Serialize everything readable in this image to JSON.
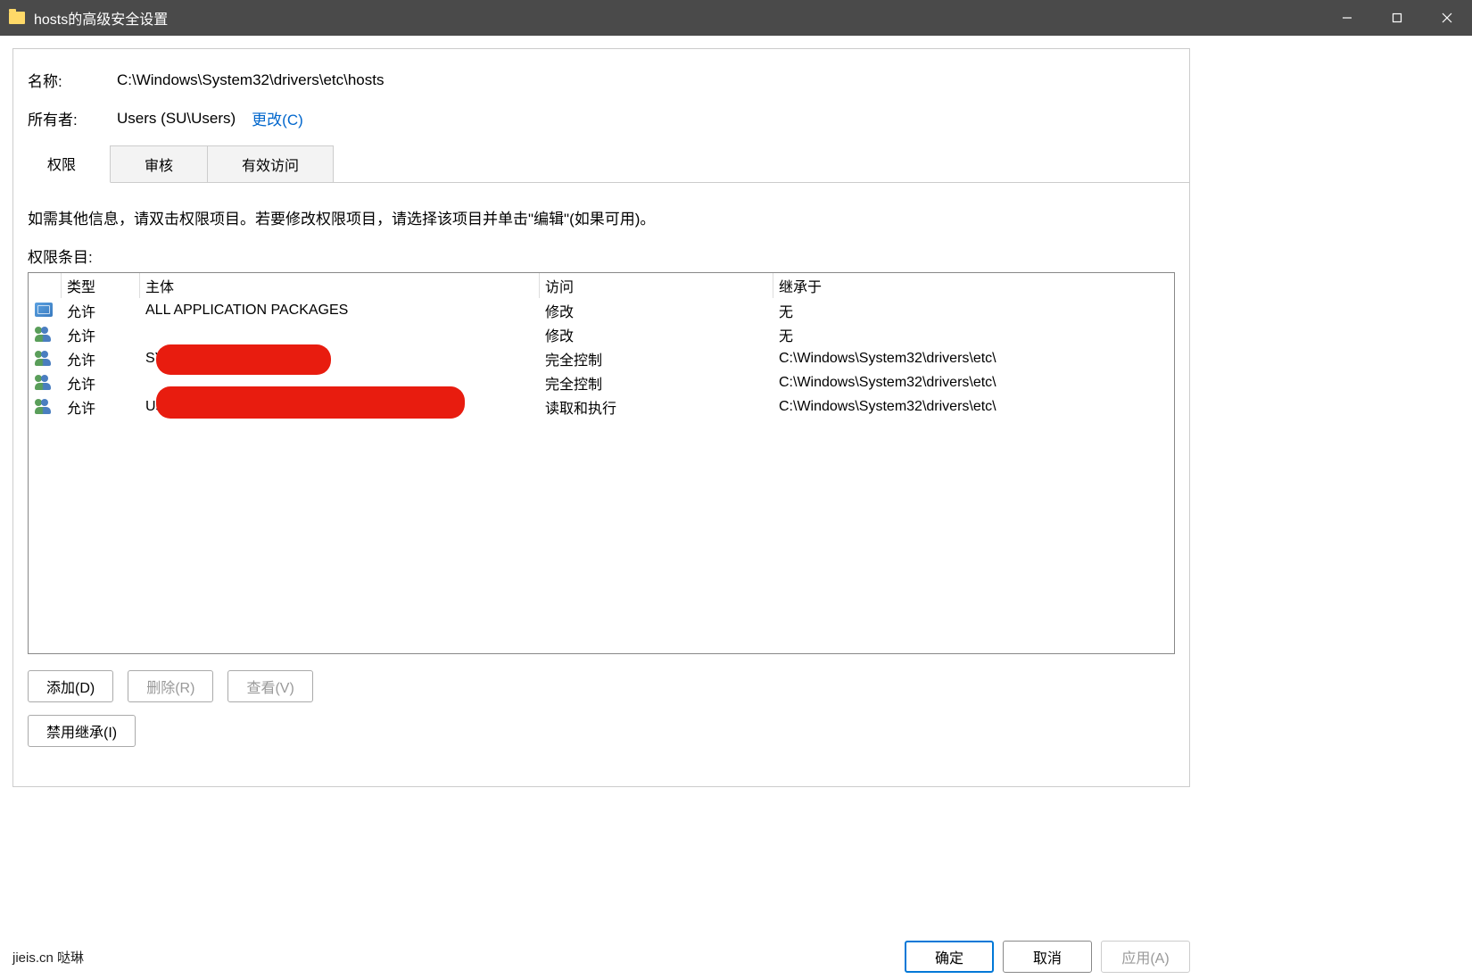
{
  "titlebar": {
    "title": "hosts的高级安全设置"
  },
  "fields": {
    "name_label": "名称:",
    "name_value": "C:\\Windows\\System32\\drivers\\etc\\hosts",
    "owner_label": "所有者:",
    "owner_value": "Users (SU\\Users)",
    "change_link": "更改(C)"
  },
  "tabs": {
    "perm": "权限",
    "audit": "审核",
    "effective": "有效访问"
  },
  "info_text": "如需其他信息，请双击权限项目。若要修改权限项目，请选择该项目并单击\"编辑\"(如果可用)。",
  "list_label": "权限条目:",
  "columns": {
    "type": "类型",
    "principal": "主体",
    "access": "访问",
    "inherit": "继承于"
  },
  "rows": [
    {
      "icon": "app",
      "type": "允许",
      "principal": "ALL APPLICATION PACKAGES",
      "access": "修改",
      "inherit": "无"
    },
    {
      "icon": "users",
      "type": "允许",
      "principal": "",
      "access": "修改",
      "inherit": "无"
    },
    {
      "icon": "users",
      "type": "允许",
      "principal": "SYSTEM",
      "access": "完全控制",
      "inherit": "C:\\Windows\\System32\\drivers\\etc\\"
    },
    {
      "icon": "users",
      "type": "允许",
      "principal": "",
      "access": "完全控制",
      "inherit": "C:\\Windows\\System32\\drivers\\etc\\"
    },
    {
      "icon": "users",
      "type": "允许",
      "principal": "Users (SU\\Users)",
      "access": "读取和执行",
      "inherit": "C:\\Windows\\System32\\drivers\\etc\\"
    }
  ],
  "buttons": {
    "add": "添加(D)",
    "remove": "删除(R)",
    "view": "查看(V)",
    "disable_inherit": "禁用继承(I)"
  },
  "footer": {
    "watermark": "jieis.cn 哒琳",
    "ok": "确定",
    "cancel": "取消",
    "apply": "应用(A)"
  }
}
